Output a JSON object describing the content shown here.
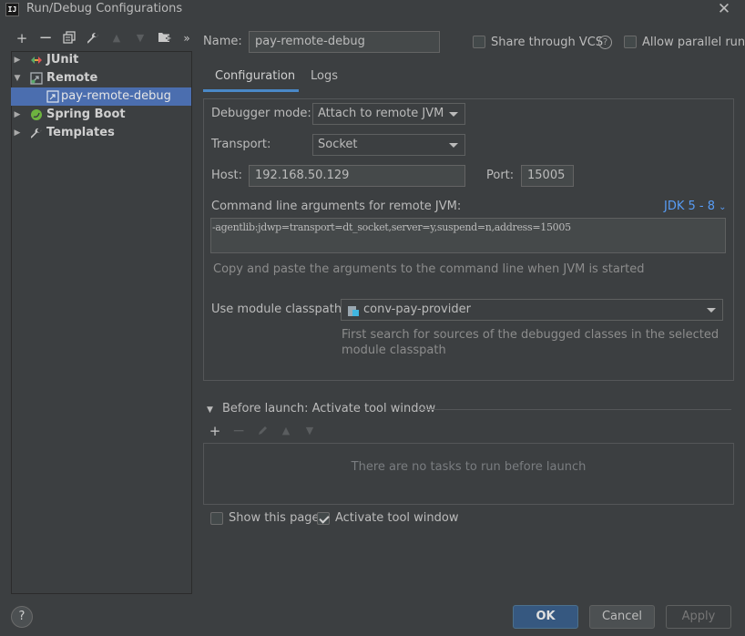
{
  "window": {
    "title": "Run/Debug Configurations",
    "app_icon_text": "IJ"
  },
  "toolbar": {
    "icons": [
      "add-icon",
      "remove-icon",
      "copy-icon",
      "wrench-icon",
      "move-up-icon",
      "move-down-icon",
      "new-folder-icon",
      "more-icon"
    ]
  },
  "tree": {
    "junit": "JUnit",
    "remote": "Remote",
    "pay_remote_debug": "pay-remote-debug",
    "spring_boot": "Spring Boot",
    "templates": "Templates"
  },
  "header": {
    "name_label": "Name:",
    "name_value": "pay-remote-debug",
    "share_vcs": "Share through VCS",
    "allow_parallel": "Allow parallel run"
  },
  "tabs": {
    "configuration": "Configuration",
    "logs": "Logs"
  },
  "config": {
    "debugger_mode_label": "Debugger mode:",
    "debugger_mode_value": "Attach to remote JVM",
    "transport_label": "Transport:",
    "transport_value": "Socket",
    "host_label": "Host:",
    "host_value": "192.168.50.129",
    "port_label": "Port:",
    "port_value": "15005",
    "cmd_label": "Command line arguments for remote JVM:",
    "jdk_selector": "JDK 5 - 8",
    "cmd_value": "-agentlib:jdwp=transport=dt_socket,server=y,suspend=n,address=15005",
    "cmd_hint": "Copy and paste the arguments to the command line when JVM is started",
    "module_label": "Use module classpath:",
    "module_value": "conv-pay-provider",
    "module_hint_line1": "First search for sources of the debugged classes in the selected",
    "module_hint_line2": "module classpath"
  },
  "before_launch": {
    "title": "Before launch: Activate tool window",
    "empty_text": "There are no tasks to run before launch",
    "show_page": "Show this page",
    "activate_tool_window": "Activate tool window"
  },
  "buttons": {
    "ok": "OK",
    "cancel": "Cancel",
    "apply": "Apply",
    "help": "?"
  },
  "colors": {
    "background": "#3c3f41",
    "selection": "#4b6eaf",
    "accent": "#4a88c7",
    "link": "#589df6",
    "primary_button": "#365880"
  }
}
